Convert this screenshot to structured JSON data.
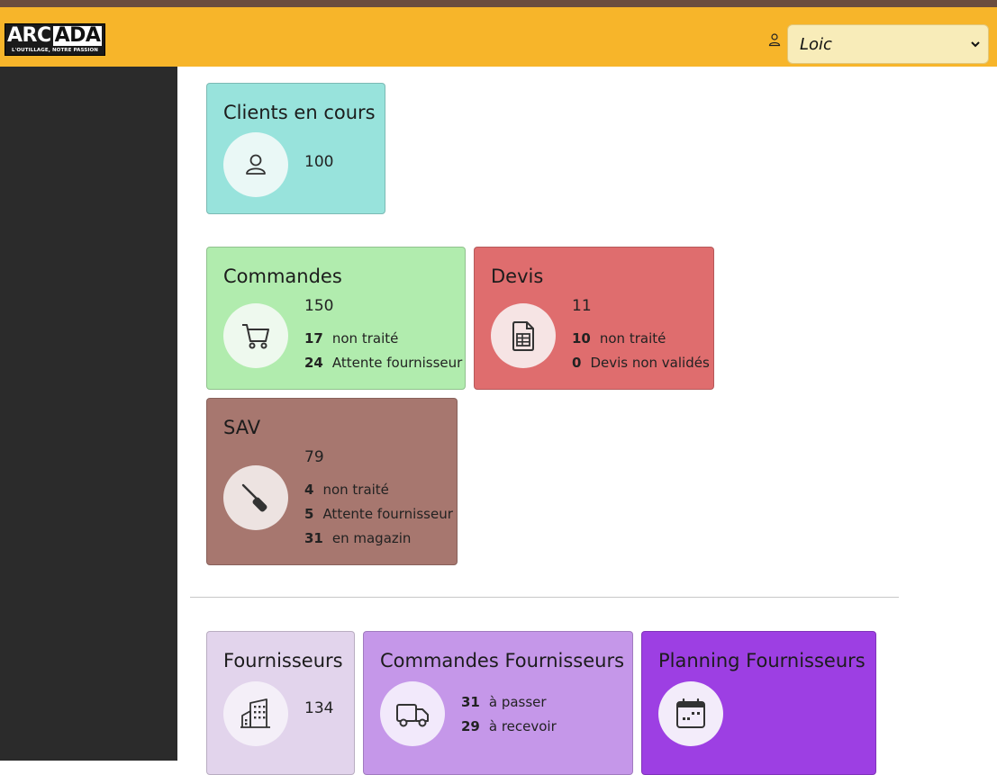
{
  "header": {
    "logo_main_left": "ARC",
    "logo_main_right": "ADA",
    "logo_tagline": "L'OUTILLAGE, NOTRE PASSION",
    "user_selected": "Loic"
  },
  "colors": {
    "header": "#f7b52a",
    "sidebar": "#2b2b2b",
    "clients": "#98e3dc",
    "commandes": "#b1ecae",
    "devis": "#df6d6e",
    "sav": "#a7776f",
    "fournisseurs": "#e2d4ec",
    "commandes_fournisseurs": "#c597e9",
    "planning_fournisseurs": "#9d3fe3"
  },
  "cards": {
    "clients": {
      "title": "Clients en cours",
      "icon": "person-icon",
      "count": "100"
    },
    "commandes": {
      "title": "Commandes",
      "icon": "cart-icon",
      "count": "150",
      "stats": [
        {
          "value": "17",
          "label": "non traité"
        },
        {
          "value": "24",
          "label": "Attente fournisseur"
        }
      ]
    },
    "devis": {
      "title": "Devis",
      "icon": "spreadsheet-file-icon",
      "count": "11",
      "stats": [
        {
          "value": "10",
          "label": "non traité"
        },
        {
          "value": "0",
          "label": "Devis non validés"
        }
      ]
    },
    "sav": {
      "title": "SAV",
      "icon": "screwdriver-icon",
      "count": "79",
      "stats": [
        {
          "value": "4",
          "label": "non traité"
        },
        {
          "value": "5",
          "label": "Attente fournisseur"
        },
        {
          "value": "31",
          "label": "en magazin"
        }
      ]
    },
    "fournisseurs": {
      "title": "Fournisseurs",
      "icon": "buildings-icon",
      "count": "134"
    },
    "commandes_fournisseurs": {
      "title": "Commandes Fournisseurs",
      "icon": "truck-icon",
      "stats": [
        {
          "value": "31",
          "label": "à passer"
        },
        {
          "value": "29",
          "label": "à recevoir"
        }
      ]
    },
    "planning_fournisseurs": {
      "title": "Planning Fournisseurs",
      "icon": "calendar-icon"
    }
  }
}
